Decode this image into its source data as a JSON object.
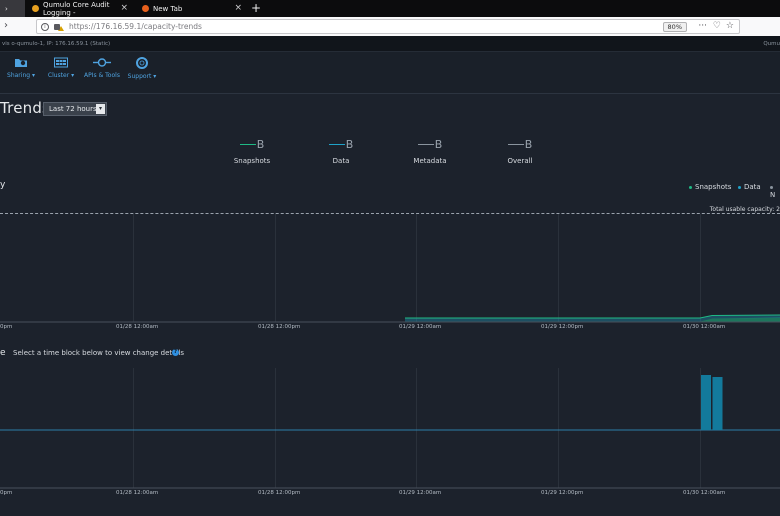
{
  "browser": {
    "tabs": [
      {
        "label": "Qumulo Core Audit Logging -",
        "active": false
      },
      {
        "label": "New Tab",
        "active": false
      }
    ],
    "url": {
      "host": "https://176.16.59.1",
      "path": "/capacity-trends"
    },
    "zoom": "80%"
  },
  "status": {
    "left": "vis o-qumulo-1, IP: 176.16.59.1 (Static)",
    "right": "Qumu"
  },
  "menu": [
    {
      "label": "Sharing",
      "icon": "folder-icon"
    },
    {
      "label": "Cluster",
      "icon": "cluster-icon"
    },
    {
      "label": "APIs & Tools",
      "icon": "api-icon"
    },
    {
      "label": "Support",
      "icon": "support-icon"
    }
  ],
  "page": {
    "title": "Trends",
    "range": "Last 72 hours"
  },
  "summary": [
    {
      "value": "B",
      "label": "Snapshots",
      "color": "#1fb985"
    },
    {
      "value": "B",
      "label": "Data",
      "color": "#1fa2c8"
    },
    {
      "value": "B",
      "label": "Metadata",
      "color": "#8a949e"
    },
    {
      "value": "B",
      "label": "Overall",
      "color": "#8a949e"
    }
  ],
  "capacity": {
    "section_title": "y",
    "legend": [
      {
        "label": "Snapshots",
        "color": "#1fb985"
      },
      {
        "label": "Data",
        "color": "#1fa2c8"
      },
      {
        "label": "N",
        "color": "#8a949e"
      }
    ],
    "usable_label": "Total usable capacity: 2",
    "xticks": [
      "0pm",
      "01/28 12:00am",
      "01/28 12:00pm",
      "01/29 12:00am",
      "01/29 12:00pm",
      "01/30 12:00am"
    ]
  },
  "change": {
    "section_title": "e",
    "hint": "Select a time block below to view change details",
    "help": "?",
    "xticks": [
      "0pm",
      "01/28 12:00am",
      "01/28 12:00pm",
      "01/29 12:00am",
      "01/29 12:00pm",
      "01/30 12:00am"
    ]
  },
  "colors": {
    "accent": "#4fa3e0",
    "snapshots": "#1fb985",
    "data": "#1fa2c8",
    "bars": "#137a9c"
  }
}
